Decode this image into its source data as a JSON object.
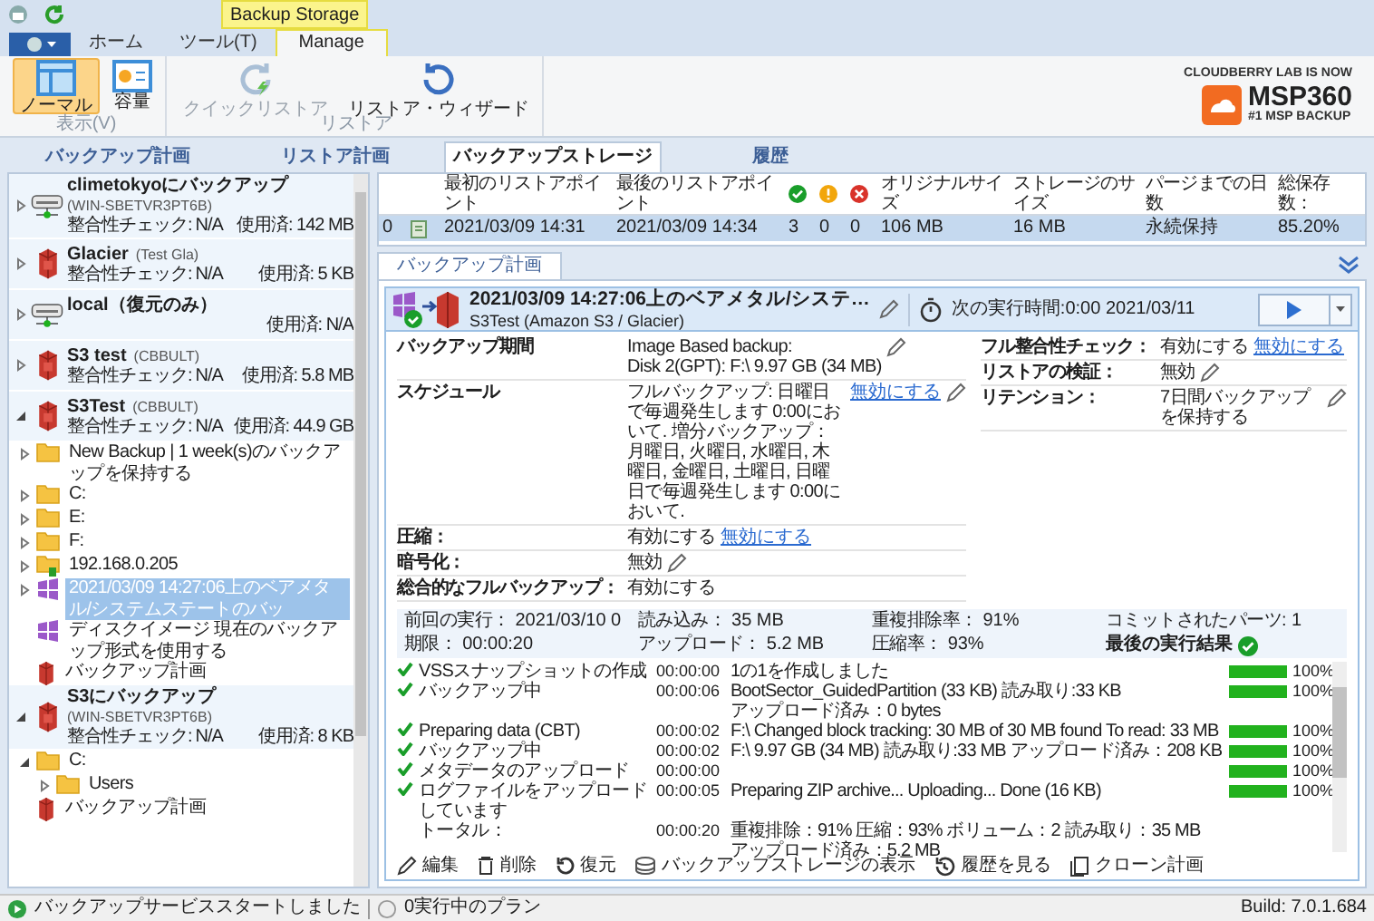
{
  "title_bar": {
    "context_tab": "Backup Storage"
  },
  "ribbon": {
    "tabs": [
      {
        "label": "ホーム",
        "selected": false
      },
      {
        "label": "ツール(T)",
        "selected": false
      },
      {
        "label": "Manage",
        "selected": true
      }
    ],
    "groups": [
      {
        "label": "表示(V)",
        "buttons": [
          {
            "label": "ノーマル",
            "kind": "layout",
            "selected": true,
            "disabled": false
          },
          {
            "label": "容量",
            "kind": "capacity",
            "selected": false,
            "disabled": false
          }
        ]
      },
      {
        "label": "リストア",
        "buttons": [
          {
            "label": "クイックリストア",
            "kind": "quick",
            "selected": false,
            "disabled": true
          },
          {
            "label": "リストア・ウィザード",
            "kind": "wizard",
            "selected": false,
            "disabled": false
          }
        ]
      }
    ]
  },
  "logo": {
    "tagline": "CLOUDBERRY LAB IS NOW",
    "brand": "MSP360",
    "slogan": "#1 MSP BACKUP"
  },
  "main_tabs": [
    {
      "label": "バックアップ計画",
      "selected": false
    },
    {
      "label": "リストア計画",
      "selected": false
    },
    {
      "label": "バックアップストレージ",
      "selected": true
    },
    {
      "label": "履歴",
      "selected": false
    }
  ],
  "storage_tree": [
    {
      "kind": "drive",
      "name": "climetokyoにバックアップ",
      "host": "(WIN-SBETVR3PT6B)",
      "check_label": "整合性チェック:",
      "check_value": "N/A",
      "used": "使用済: 142 MB",
      "expanded": false
    },
    {
      "kind": "bucket",
      "name": "Glacier",
      "host": "(Test Gla)",
      "check_label": "整合性チェック:",
      "check_value": "N/A",
      "used": "使用済: 5 KB",
      "expanded": false
    },
    {
      "kind": "drive",
      "name": "local（復元のみ）",
      "used": "使用済: N/A",
      "expanded": false
    },
    {
      "kind": "bucket",
      "name": "S3 test",
      "host": "(CBBULT)",
      "check_label": "整合性チェック:",
      "check_value": "N/A",
      "used": "使用済: 5.8 MB",
      "expanded": false
    },
    {
      "kind": "bucket",
      "name": "S3Test",
      "host": "(CBBULT)",
      "check_label": "整合性チェック:",
      "check_value": "N/A",
      "used": "使用済: 44.9 GB",
      "expanded": true,
      "children": [
        {
          "kind": "folder",
          "label": "New Backup  |  1 week(s)のバックアップを保持する",
          "expanded": false,
          "selected": false
        },
        {
          "kind": "folder",
          "label": "C:",
          "expanded": false,
          "selected": false
        },
        {
          "kind": "folder",
          "label": "E:",
          "expanded": false,
          "selected": false
        },
        {
          "kind": "folder",
          "label": "F:",
          "expanded": false,
          "selected": false
        },
        {
          "kind": "network",
          "label": "192.168.0.205",
          "expanded": false,
          "selected": false
        },
        {
          "kind": "tiles",
          "label": "2021/03/09 14:27:06上のベアメタル/システムステートのバッ",
          "expanded": false,
          "selected": true
        },
        {
          "kind": "tiles",
          "label": "ディスクイメージ 現在のバックアップ形式を使用する",
          "selected": false
        },
        {
          "kind": "plan",
          "label": "バックアップ計画",
          "selected": false
        }
      ]
    },
    {
      "kind": "bucket",
      "name": "S3にバックアップ",
      "host": "(WIN-SBETVR3PT6B)",
      "check_label": "整合性チェック:",
      "check_value": "N/A",
      "used": "使用済: 8 KB",
      "expanded": true,
      "children": [
        {
          "kind": "folder",
          "label": "C:",
          "expanded": true,
          "selected": false,
          "children": [
            {
              "kind": "folder",
              "label": "Users",
              "expanded": false,
              "selected": false
            }
          ]
        },
        {
          "kind": "plan",
          "label": "バックアップ計画",
          "selected": false
        }
      ]
    }
  ],
  "table": {
    "columns": [
      {
        "kind": "text",
        "label": "最初のリストアポイント"
      },
      {
        "kind": "text",
        "label": "最後のリストアポイント"
      },
      {
        "kind": "success"
      },
      {
        "kind": "warning"
      },
      {
        "kind": "error"
      },
      {
        "kind": "text",
        "label": "オリジナルサイズ"
      },
      {
        "kind": "text",
        "label": "ストレージのサイズ"
      },
      {
        "kind": "text",
        "label": "パージまでの日数"
      },
      {
        "kind": "text",
        "label": "総保存数："
      }
    ],
    "rows": [
      {
        "index": "0",
        "selected": true,
        "cells": [
          "2021/03/09 14:31",
          "2021/03/09 14:34",
          "3",
          "0",
          "0",
          "106 MB",
          "16 MB",
          "永続保持",
          "85.20%"
        ]
      }
    ]
  },
  "detail_tabs": [
    {
      "label": "バックアップ計画",
      "selected": true
    }
  ],
  "plan": {
    "title": "2021/03/09 14:27:06上のベアメタル/システ…",
    "subtitle": "S3Test (Amazon S3 / Glacier)",
    "next_run": "次の実行時間:0:00 2021/03/11",
    "details_left": [
      {
        "label": "バックアップ期間",
        "value": "Image Based backup:\nDisk 2(GPT):  F:\\ 9.97 GB (34 MB)",
        "editable": true
      },
      {
        "label": "スケジュール",
        "value": "フルバックアップ: 日曜日で毎週発生します 0:00において. 増分バックアップ：月曜日, 火曜日, 水曜日, 木曜日, 金曜日, 土曜日, 日曜日で毎週発生します 0:00において.",
        "link": "無効にする",
        "editable": true
      },
      {
        "label": "圧縮：",
        "value": "有効にする",
        "link": "無効にする",
        "editable": false
      },
      {
        "label": "暗号化：",
        "value": "無効",
        "editable": true
      },
      {
        "label": "総合的なフルバックアップ：",
        "value": "有効にする",
        "editable": false
      }
    ],
    "details_right": [
      {
        "label": "フル整合性チェック：",
        "value": "有効にする",
        "link": "無効にする",
        "editable": false
      },
      {
        "label": "リストアの検証：",
        "value": "無効",
        "editable": true
      },
      {
        "label": "リテンション：",
        "value": "7日間バックアップを保持する",
        "editable": true
      }
    ],
    "stats": [
      {
        "kind": "text",
        "label": "前回の実行：",
        "value": "2021/03/10 0"
      },
      {
        "kind": "text",
        "label": "期限：",
        "value": "00:00:20"
      },
      {
        "kind": "text",
        "label": "読み込み：",
        "value": "35 MB"
      },
      {
        "kind": "text",
        "label": "アップロード：",
        "value": "5.2 MB"
      },
      {
        "kind": "text",
        "label": "重複排除率：",
        "value": "91%"
      },
      {
        "kind": "text",
        "label": "圧縮率：",
        "value": "93%"
      },
      {
        "kind": "text",
        "label": "コミットされたパーツ:",
        "value": "1"
      },
      {
        "kind": "result",
        "label": "最後の実行結果"
      }
    ],
    "log": [
      {
        "kind": "step",
        "name": "VSSスナップショットの作成",
        "time": "00:00:00",
        "message": [
          "1の1を作成しました"
        ],
        "level": 1,
        "percent": "100%"
      },
      {
        "kind": "step",
        "name": "バックアップ中",
        "time": "00:00:06",
        "message": [
          "BootSector_GuidedPartition (33 KB) 読み取り:33 KB",
          "アップロード済み：0 bytes"
        ],
        "level": 1,
        "percent": "100%"
      },
      {
        "kind": "step",
        "name": "Preparing data (CBT)",
        "time": "00:00:02",
        "message": [
          "F:\\ Changed block tracking: 30 MB of 30 MB found To read: 33 MB"
        ],
        "level": 1,
        "percent": "100%"
      },
      {
        "kind": "step",
        "name": "バックアップ中",
        "time": "00:00:02",
        "message": [
          "F:\\ 9.97 GB (34 MB) 読み取り:33 MB  アップロード済み：208 KB"
        ],
        "level": 1,
        "percent": "100%"
      },
      {
        "kind": "step",
        "name": "メタデータのアップロード",
        "time": "00:00:00",
        "level": 1,
        "percent": "100%"
      },
      {
        "kind": "step",
        "name": "ログファイルをアップロードしています",
        "time": "00:00:05",
        "message": [
          "Preparing ZIP archive... Uploading... Done (16 KB)"
        ],
        "level": 1,
        "percent": "100%"
      },
      {
        "kind": "total",
        "name": "トータル：",
        "time": "00:00:20",
        "message": [
          "重複排除：91%  圧縮：93%  ボリューム：2  読み取り：35 MB",
          "アップロード済み：5.2 MB"
        ]
      }
    ],
    "actions": [
      {
        "kind": "edit",
        "label": "編集"
      },
      {
        "kind": "delete",
        "label": "削除"
      },
      {
        "kind": "restore",
        "label": "復元"
      },
      {
        "kind": "storage",
        "label": "バックアップストレージの表示"
      },
      {
        "kind": "history",
        "label": "履歴を見る"
      },
      {
        "kind": "clone",
        "label": "クローン計画"
      }
    ]
  },
  "status_bar": {
    "service": "バックアップサービススタートしました",
    "running": "0実行中のプラン",
    "build": "Build: 7.0.1.684"
  }
}
